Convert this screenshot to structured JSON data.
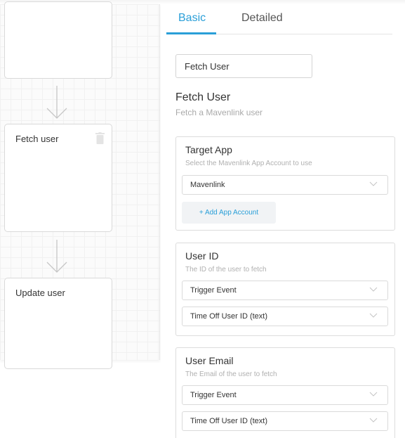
{
  "canvas": {
    "steps": [
      {
        "title": ""
      },
      {
        "title": "Fetch user"
      },
      {
        "title": "Update user"
      }
    ]
  },
  "tabs": {
    "basic": "Basic",
    "detailed": "Detailed"
  },
  "step_name_input": {
    "value": "Fetch User"
  },
  "step_info": {
    "title": "Fetch User",
    "subtitle": "Fetch a Mavenlink user"
  },
  "fields": {
    "target_app": {
      "label": "Target App",
      "description": "Select the Mavenlink App Account to use",
      "select_value": "Mavenlink",
      "add_button": "+ Add App Account"
    },
    "user_id": {
      "label": "User ID",
      "description": "The ID of the user to fetch",
      "select1": "Trigger Event",
      "select2": "Time Off User ID (text)"
    },
    "user_email": {
      "label": "User Email",
      "description": "The Email of the user to fetch",
      "select1": "Trigger Event",
      "select2": "Time Off User ID (text)"
    }
  },
  "icons": {
    "trash": "trash-icon",
    "arrow": "arrow-down-icon",
    "chevron": "chevron-down-icon"
  },
  "colors": {
    "accent": "#2a9fd8",
    "border": "#dcdcdc",
    "muted": "#aaaaaa"
  }
}
